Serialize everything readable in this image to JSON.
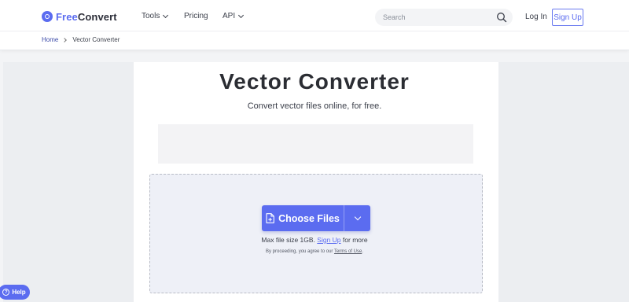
{
  "brand": {
    "part1": "Free",
    "part2": "Convert"
  },
  "nav": {
    "tools": "Tools",
    "pricing": "Pricing",
    "api": "API"
  },
  "search": {
    "placeholder": "Search"
  },
  "auth": {
    "login": "Log In",
    "signup": "Sign Up"
  },
  "breadcrumb": {
    "home": "Home",
    "current": "Vector Converter"
  },
  "main": {
    "title": "Vector Converter",
    "subtitle": "Convert vector files online, for free."
  },
  "upload": {
    "button_label": "Choose Files",
    "max_size_prefix": "Max file size 1GB.",
    "max_size_link": "Sign Up",
    "max_size_suffix": "for more",
    "agree_prefix": "By proceeding, you agree to our",
    "agree_link": "Terms of Use",
    "agree_suffix": "."
  },
  "help": {
    "label": "Help"
  },
  "colors": {
    "accent": "#5b6cf0",
    "dropzone_bg": "#eef0f7"
  },
  "icons": {
    "logo": "freeconvert-logo-icon",
    "search": "search-icon",
    "file": "file-plus-icon",
    "dropdown": "chevron-down-icon",
    "help": "question-circle-icon"
  }
}
